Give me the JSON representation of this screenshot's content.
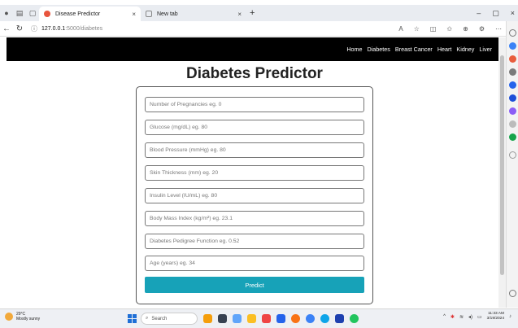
{
  "browser": {
    "tabs": [
      {
        "title": "Disease Predictor",
        "active": true
      },
      {
        "title": "New tab",
        "active": false
      }
    ],
    "new_tab_glyph": "+",
    "tab_close_glyph": "×",
    "url_host": "127.0.0.1",
    "url_path": ":5000/diabetes",
    "window_controls": [
      "–",
      "▢",
      "×"
    ]
  },
  "site_nav": {
    "links": [
      "Home",
      "Diabetes",
      "Breast Cancer",
      "Heart",
      "Kidney",
      "Liver"
    ]
  },
  "page": {
    "title": "Diabetes Predictor",
    "fields": [
      {
        "placeholder": "Number of Pregnancies eg. 0"
      },
      {
        "placeholder": "Glucose (mg/dL) eg. 80"
      },
      {
        "placeholder": "Blood Pressure (mmHg) eg. 80"
      },
      {
        "placeholder": "Skin Thickness (mm) eg. 20"
      },
      {
        "placeholder": "Insulin Level (IU/mL) eg. 80"
      },
      {
        "placeholder": "Body Mass Index (kg/m²) eg. 23.1"
      },
      {
        "placeholder": "Diabetes Pedigree Function eg. 0.52"
      },
      {
        "placeholder": "Age (years) eg. 34"
      }
    ],
    "submit_label": "Predict"
  },
  "taskbar": {
    "weather_temp": "29°C",
    "weather_desc": "Mostly sunny",
    "search_label": "Search",
    "time": "11:33 AM",
    "date": "3/19/2024"
  },
  "colors": {
    "nav_bg": "#000000",
    "button_bg": "#17a2b8",
    "tab_favicon": "#e8553d"
  }
}
